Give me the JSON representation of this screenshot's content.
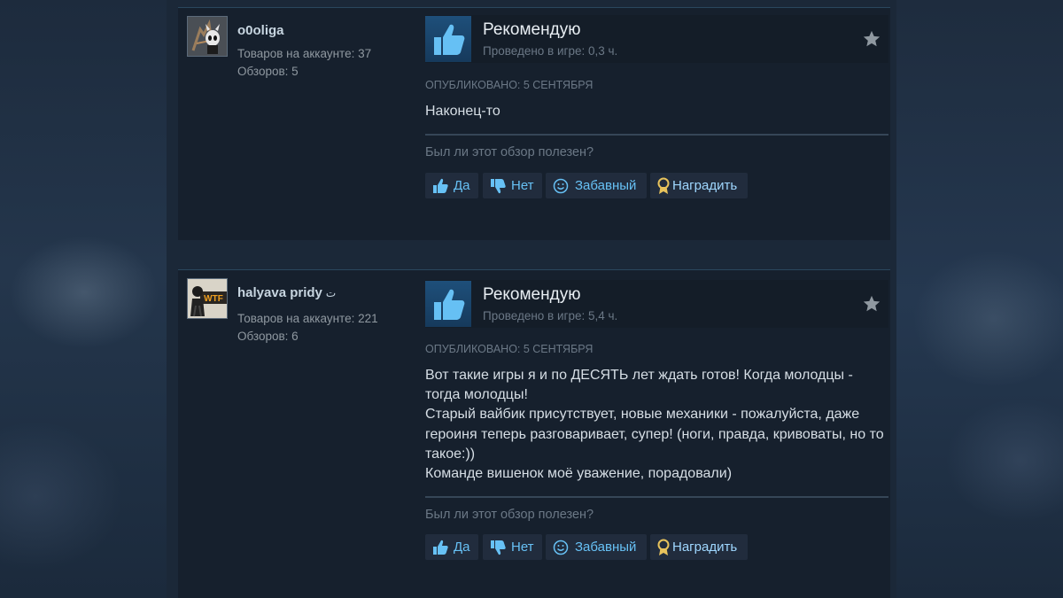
{
  "reviews": [
    {
      "author": {
        "name": "o0oliga",
        "name_symbol": "",
        "products_label": "Товаров на аккаунте: 37",
        "reviews_label": "Обзоров: 5"
      },
      "verdict": "Рекомендую",
      "hours": "Проведено в игре: 0,3 ч.",
      "posted": "ОПУБЛИКОВАНО: 5 СЕНТЯБРЯ",
      "text_lines": [
        "Наконец-то"
      ],
      "helpful_question": "Был ли этот обзор полезен?"
    },
    {
      "author": {
        "name": "halyava pridy",
        "name_symbol": "ت",
        "products_label": "Товаров на аккаунте: 221",
        "reviews_label": "Обзоров: 6"
      },
      "verdict": "Рекомендую",
      "hours": "Проведено в игре: 5,4 ч.",
      "posted": "ОПУБЛИКОВАНО: 5 СЕНТЯБРЯ",
      "text_lines": [
        "Вот такие игры я и по ДЕСЯТЬ лет ждать готов! Когда молодцы - тогда молодцы!",
        "Старый вайбик присутствует, новые механики - пожалуйста, даже героиня теперь разговаривает, супер! (ноги, правда, кривоваты, но то такое:))",
        "Команде вишенок моё уважение, порадовали)"
      ],
      "helpful_question": "Был ли этот обзор полезен?"
    }
  ],
  "buttons": {
    "yes": "Да",
    "no": "Нет",
    "funny": "Забавный",
    "award": "Наградить"
  },
  "avatar_badge": "WTF",
  "icons": {
    "verdict": "thumbs-up-icon",
    "star": "star-icon",
    "yes": "thumbs-up-icon",
    "no": "thumbs-down-icon",
    "funny": "smiley-icon",
    "award": "award-ribbon-icon"
  },
  "colors": {
    "background": "#1b2838",
    "card": "#16202d",
    "link_blue": "#67c1f5",
    "muted_text": "#6b7886",
    "body_text": "#d6dee5"
  }
}
